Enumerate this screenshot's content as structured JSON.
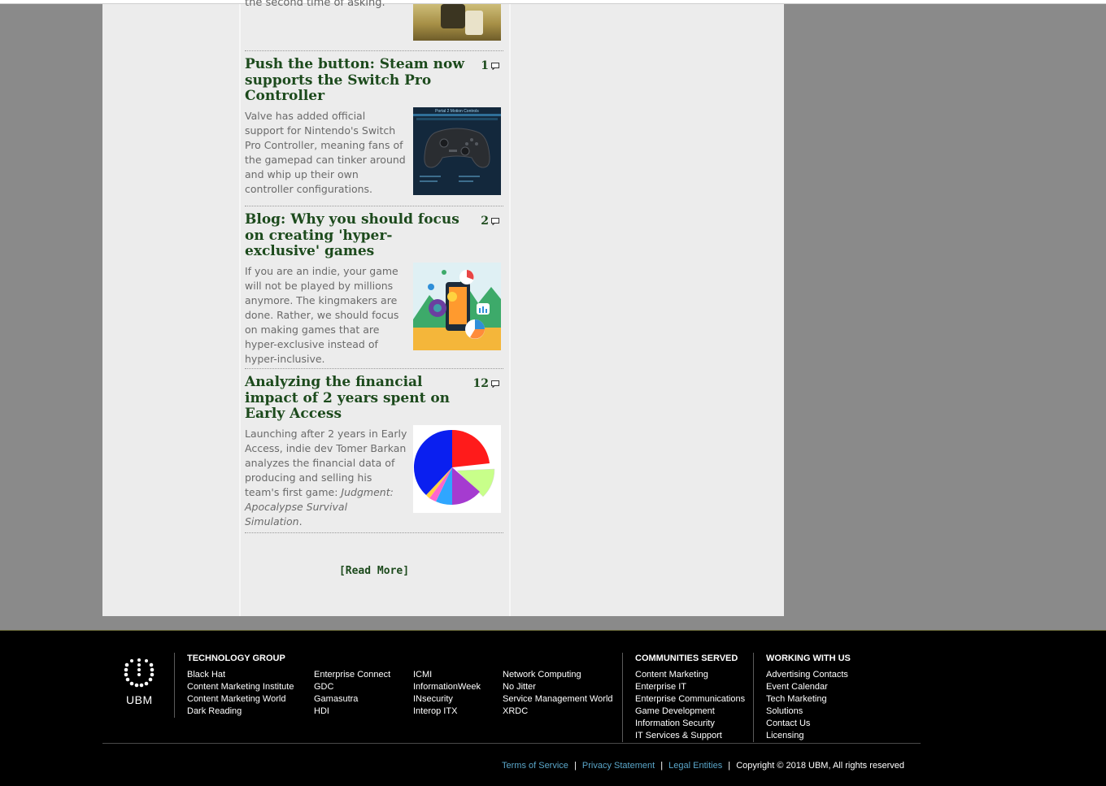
{
  "news": {
    "first_teaser": "the second time of asking.",
    "articles": [
      {
        "title": "Push the button: Steam now supports the Switch Pro Controller",
        "comments": "1",
        "text": "Valve has added official support for Nintendo's Switch Pro Controller, meaning fans of the gamepad can tinker around and whip up their own controller configurations.",
        "thumb_icon": "switch-pro-controller-image",
        "thumb_caption": "Portal 2 Motion Controls"
      },
      {
        "title": "Blog: Why you should focus on creating 'hyper-exclusive' games",
        "comments": "2",
        "text": "If you are an indie, your game will not be played by millions anymore. The kingmakers are done. Rather, we should focus on making games that are hyper-exclusive instead of hyper-inclusive.",
        "thumb_icon": "mobile-analytics-illustration"
      },
      {
        "title": "Analyzing the financial impact of 2 years spent on Early Access",
        "comments": "12",
        "text_plain": "Launching after 2 years in Early Access, indie dev Tomer Barkan analyzes the financial data of producing and selling his team's first game:",
        "text_italic": "Judgment: Apocalypse Survival Simulation",
        "text_end": ".",
        "thumb_icon": "pie-chart-image"
      }
    ],
    "read_more": "[Read More]"
  },
  "footer": {
    "logo_text": "UBM",
    "technology_group": {
      "heading": "TECHNOLOGY GROUP",
      "col1": [
        "Black Hat",
        "Content Marketing Institute",
        "Content Marketing World",
        "Dark Reading"
      ],
      "col2": [
        "Enterprise Connect",
        "GDC",
        "Gamasutra",
        "HDI"
      ],
      "col3": [
        "ICMI",
        "InformationWeek",
        "INsecurity",
        "Interop ITX"
      ],
      "col4": [
        "Network Computing",
        "No Jitter",
        "Service Management World",
        "XRDC"
      ]
    },
    "communities": {
      "heading": "COMMUNITIES SERVED",
      "items": [
        "Content Marketing",
        "Enterprise IT",
        "Enterprise Communications",
        "Game Development",
        "Information Security",
        "IT Services & Support"
      ]
    },
    "working": {
      "heading": "WORKING WITH US",
      "items": [
        "Advertising Contacts",
        "Event Calendar",
        "Tech Marketing",
        "Solutions",
        "Contact Us",
        "Licensing"
      ]
    },
    "legal": {
      "terms": "Terms of Service",
      "privacy": "Privacy Statement",
      "entities": "Legal Entities",
      "copyright": "Copyright © 2018 UBM, All rights reserved",
      "separator": "|"
    }
  }
}
